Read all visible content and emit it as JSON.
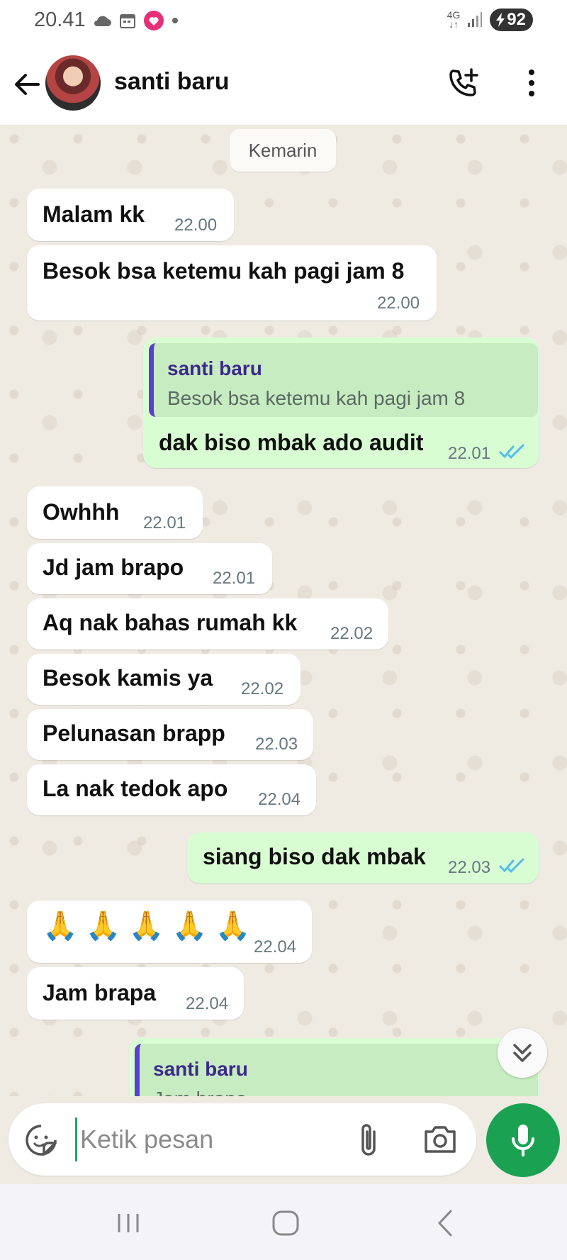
{
  "status_bar": {
    "time": "20.41",
    "network": "4G",
    "battery": "92",
    "icons": [
      "cloud-icon",
      "calendar-icon",
      "lazada-app-icon",
      "dot-icon",
      "signal-icon",
      "battery-charging-icon"
    ]
  },
  "header": {
    "contact_name": "santi baru",
    "icons": [
      "back-arrow-icon",
      "avatar",
      "add-call-icon",
      "more-vert-icon"
    ]
  },
  "chat": {
    "date_separator": "Kemarin",
    "messages": [
      {
        "dir": "in",
        "text": "Malam kk",
        "time": "22.00"
      },
      {
        "dir": "in",
        "text": "Besok bsa ketemu kah pagi jam 8",
        "time": "22.00"
      },
      {
        "dir": "out",
        "quote_name": "santi baru",
        "quote_text": "Besok bsa ketemu kah pagi jam 8",
        "text": "dak biso mbak ado audit",
        "time": "22.01",
        "status": "read"
      },
      {
        "dir": "in",
        "text": "Owhhh",
        "time": "22.01"
      },
      {
        "dir": "in",
        "text": "Jd jam brapo",
        "time": "22.01"
      },
      {
        "dir": "in",
        "text": "Aq nak bahas rumah kk",
        "time": "22.02"
      },
      {
        "dir": "in",
        "text": "Besok kamis ya",
        "time": "22.02"
      },
      {
        "dir": "in",
        "text": "Pelunasan brapp",
        "time": "22.03"
      },
      {
        "dir": "in",
        "text": "La nak tedok apo",
        "time": "22.04"
      },
      {
        "dir": "out",
        "text": "siang biso dak mbak",
        "time": "22.03",
        "status": "read"
      },
      {
        "dir": "in",
        "emoji": "🙏 🙏 🙏 🙏 🙏",
        "time": "22.04"
      },
      {
        "dir": "in",
        "text": "Jam brapa",
        "time": "22.04"
      },
      {
        "dir": "out",
        "quote_name": "santi baru",
        "quote_text": "Jam brapa",
        "partial": true
      }
    ]
  },
  "composer": {
    "placeholder": "Ketik pesan",
    "icons": [
      "sticker-icon",
      "paperclip-icon",
      "camera-icon",
      "mic-icon"
    ]
  },
  "navbar": {
    "icons": [
      "recent-apps-icon",
      "home-icon",
      "back-nav-icon"
    ]
  },
  "colors": {
    "incoming_bubble": "#ffffff",
    "outgoing_bubble": "#d9fdd3",
    "read_tick": "#53bdeb",
    "accent_green": "#1aa252",
    "chat_background": "#efeae2"
  }
}
